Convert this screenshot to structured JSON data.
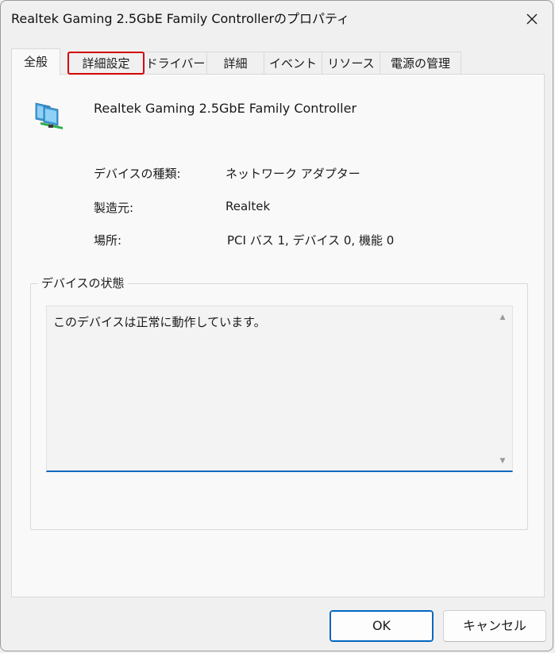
{
  "window": {
    "title": "Realtek Gaming 2.5GbE Family Controllerのプロパティ"
  },
  "tabs": [
    {
      "label": "全般",
      "active": true
    },
    {
      "label": "詳細設定",
      "focused": true
    },
    {
      "label": "ドライバー"
    },
    {
      "label": "詳細"
    },
    {
      "label": "イベント"
    },
    {
      "label": "リソース"
    },
    {
      "label": "電源の管理"
    }
  ],
  "general": {
    "device_icon": "network-adapter-icon",
    "device_name": "Realtek Gaming 2.5GbE Family Controller",
    "properties": [
      {
        "label": "デバイスの種類:",
        "value": "ネットワーク アダプター"
      },
      {
        "label": "製造元:",
        "value": "Realtek"
      },
      {
        "label": "場所:",
        "value": "PCI バス 1, デバイス 0, 機能 0"
      }
    ],
    "status_group_title": "デバイスの状態",
    "status_text": "このデバイスは正常に動作しています。"
  },
  "buttons": {
    "ok": "OK",
    "cancel": "キャンセル"
  },
  "colors": {
    "accent": "#0067c0",
    "highlight": "#d10000",
    "panel_bg": "#f9f9f9",
    "window_bg": "#f0f0f0"
  }
}
